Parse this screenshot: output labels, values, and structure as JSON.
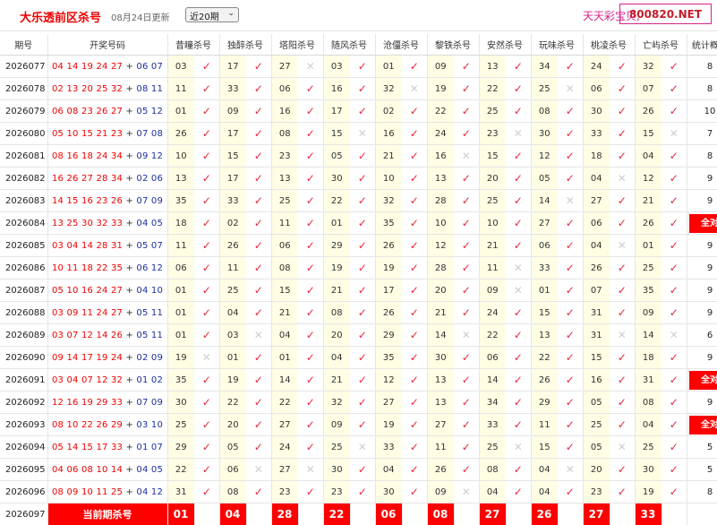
{
  "header": {
    "title": "大乐透前区杀号",
    "update": "08月24日更新",
    "range_selected": "近20期",
    "slogan": "天天彩宝贝,",
    "brand": "800820.NET"
  },
  "columns": [
    "期号",
    "开奖号码",
    "昔瞳杀号",
    "独醉杀号",
    "塔阳杀号",
    "随风杀号",
    "沧僵杀号",
    "黎铁杀号",
    "安然杀号",
    "玩味杀号",
    "桃凌杀号",
    "亡屿杀号",
    "统计概况"
  ],
  "symbols": {
    "ok": "✓",
    "no": "✕"
  },
  "rows": [
    {
      "issue": "2026077",
      "front": "04 14 19 24 27",
      "back": "06 07",
      "picks": [
        "03",
        "17",
        "27",
        "03",
        "01",
        "09",
        "13",
        "34",
        "24",
        "32"
      ],
      "hits": [
        1,
        1,
        0,
        1,
        1,
        1,
        1,
        1,
        1,
        1
      ],
      "stat": "8"
    },
    {
      "issue": "2026078",
      "front": "02 13 20 25 32",
      "back": "08 11",
      "picks": [
        "11",
        "33",
        "06",
        "16",
        "32",
        "19",
        "22",
        "25",
        "06",
        "07"
      ],
      "hits": [
        1,
        1,
        1,
        1,
        0,
        1,
        1,
        0,
        1,
        1
      ],
      "stat": "8"
    },
    {
      "issue": "2026079",
      "front": "06 08 23 26 27",
      "back": "05 12",
      "picks": [
        "01",
        "09",
        "16",
        "17",
        "02",
        "22",
        "25",
        "08",
        "30",
        "26"
      ],
      "hits": [
        1,
        1,
        1,
        1,
        1,
        1,
        1,
        1,
        1,
        1
      ],
      "stat": "10"
    },
    {
      "issue": "2026080",
      "front": "05 10 15 21 23",
      "back": "07 08",
      "picks": [
        "26",
        "17",
        "08",
        "15",
        "16",
        "24",
        "23",
        "30",
        "33",
        "15"
      ],
      "hits": [
        1,
        1,
        1,
        0,
        1,
        1,
        0,
        1,
        1,
        0
      ],
      "stat": "7"
    },
    {
      "issue": "2026081",
      "front": "08 16 18 24 34",
      "back": "09 12",
      "picks": [
        "10",
        "15",
        "23",
        "05",
        "21",
        "16",
        "15",
        "12",
        "18",
        "04"
      ],
      "hits": [
        1,
        1,
        1,
        1,
        1,
        0,
        1,
        1,
        1,
        1
      ],
      "stat": "8"
    },
    {
      "issue": "2026082",
      "front": "16 26 27 28 34",
      "back": "02 06",
      "picks": [
        "13",
        "17",
        "13",
        "30",
        "10",
        "13",
        "20",
        "05",
        "04",
        "12"
      ],
      "hits": [
        1,
        1,
        1,
        1,
        1,
        1,
        1,
        1,
        0,
        1
      ],
      "stat": "9"
    },
    {
      "issue": "2026083",
      "front": "14 15 16 23 26",
      "back": "07 09",
      "picks": [
        "35",
        "33",
        "25",
        "22",
        "32",
        "28",
        "25",
        "14",
        "27",
        "21"
      ],
      "hits": [
        1,
        1,
        1,
        1,
        1,
        1,
        1,
        0,
        1,
        1
      ],
      "stat": "9"
    },
    {
      "issue": "2026084",
      "front": "13 25 30 32 33",
      "back": "04 05",
      "picks": [
        "18",
        "02",
        "11",
        "01",
        "35",
        "10",
        "10",
        "27",
        "06",
        "26"
      ],
      "hits": [
        1,
        1,
        1,
        1,
        1,
        1,
        1,
        1,
        1,
        1
      ],
      "stat": "全对"
    },
    {
      "issue": "2026085",
      "front": "03 04 14 28 31",
      "back": "05 07",
      "picks": [
        "11",
        "26",
        "06",
        "29",
        "26",
        "12",
        "21",
        "06",
        "04",
        "01"
      ],
      "hits": [
        1,
        1,
        1,
        1,
        1,
        1,
        1,
        1,
        0,
        1
      ],
      "stat": "9"
    },
    {
      "issue": "2026086",
      "front": "10 11 18 22 35",
      "back": "06 12",
      "picks": [
        "06",
        "11",
        "08",
        "19",
        "19",
        "28",
        "11",
        "33",
        "26",
        "25"
      ],
      "hits": [
        1,
        1,
        1,
        1,
        1,
        1,
        0,
        1,
        1,
        1
      ],
      "stat": "9"
    },
    {
      "issue": "2026087",
      "front": "05 10 16 24 27",
      "back": "04 10",
      "picks": [
        "01",
        "25",
        "15",
        "21",
        "17",
        "20",
        "09",
        "01",
        "07",
        "35"
      ],
      "hits": [
        1,
        1,
        1,
        1,
        1,
        1,
        0,
        1,
        1,
        1
      ],
      "stat": "9"
    },
    {
      "issue": "2026088",
      "front": "03 09 11 24 27",
      "back": "05 11",
      "picks": [
        "01",
        "04",
        "21",
        "08",
        "26",
        "21",
        "24",
        "15",
        "31",
        "09"
      ],
      "hits": [
        1,
        1,
        1,
        1,
        1,
        1,
        1,
        1,
        1,
        1
      ],
      "stat": "9"
    },
    {
      "issue": "2026089",
      "front": "03 07 12 14 26",
      "back": "05 11",
      "picks": [
        "01",
        "03",
        "04",
        "20",
        "29",
        "14",
        "22",
        "13",
        "31",
        "14"
      ],
      "hits": [
        1,
        0,
        1,
        1,
        1,
        0,
        1,
        1,
        0,
        0
      ],
      "stat": "6"
    },
    {
      "issue": "2026090",
      "front": "09 14 17 19 24",
      "back": "02 09",
      "picks": [
        "19",
        "01",
        "01",
        "04",
        "35",
        "30",
        "06",
        "22",
        "15",
        "18"
      ],
      "hits": [
        0,
        1,
        1,
        1,
        1,
        1,
        1,
        1,
        1,
        1
      ],
      "stat": "9"
    },
    {
      "issue": "2026091",
      "front": "03 04 07 12 32",
      "back": "01 02",
      "picks": [
        "35",
        "19",
        "14",
        "21",
        "12",
        "13",
        "14",
        "26",
        "16",
        "31"
      ],
      "hits": [
        1,
        1,
        1,
        1,
        1,
        1,
        1,
        1,
        1,
        1
      ],
      "stat": "全对"
    },
    {
      "issue": "2026092",
      "front": "12 16 19 29 33",
      "back": "07 09",
      "picks": [
        "30",
        "22",
        "22",
        "32",
        "27",
        "13",
        "34",
        "29",
        "05",
        "08"
      ],
      "hits": [
        1,
        1,
        1,
        1,
        1,
        1,
        1,
        1,
        1,
        1
      ],
      "stat": "9"
    },
    {
      "issue": "2026093",
      "front": "08 10 22 26 29",
      "back": "03 10",
      "picks": [
        "25",
        "20",
        "27",
        "09",
        "19",
        "27",
        "33",
        "11",
        "25",
        "04"
      ],
      "hits": [
        1,
        1,
        1,
        1,
        1,
        1,
        1,
        1,
        1,
        1
      ],
      "stat": "全对"
    },
    {
      "issue": "2026094",
      "front": "05 14 15 17 33",
      "back": "01 07",
      "picks": [
        "29",
        "05",
        "24",
        "25",
        "33",
        "11",
        "25",
        "15",
        "05",
        "25"
      ],
      "hits": [
        1,
        1,
        1,
        0,
        1,
        1,
        0,
        1,
        0,
        1
      ],
      "stat": "5"
    },
    {
      "issue": "2026095",
      "front": "04 06 08 10 14",
      "back": "04 05",
      "picks": [
        "22",
        "06",
        "27",
        "30",
        "04",
        "26",
        "08",
        "04",
        "20",
        "30"
      ],
      "hits": [
        1,
        0,
        0,
        1,
        1,
        1,
        1,
        0,
        1,
        1
      ],
      "stat": "5"
    },
    {
      "issue": "2026096",
      "front": "08 09 10 11 25",
      "back": "04 12",
      "picks": [
        "31",
        "08",
        "23",
        "23",
        "30",
        "09",
        "04",
        "04",
        "23",
        "19"
      ],
      "hits": [
        1,
        1,
        1,
        1,
        1,
        0,
        1,
        1,
        1,
        1
      ],
      "stat": "8"
    }
  ],
  "current": {
    "issue": "2026097",
    "label": "当前期杀号",
    "picks": [
      "01",
      "04",
      "28",
      "22",
      "06",
      "08",
      "27",
      "26",
      "27",
      "33"
    ]
  }
}
